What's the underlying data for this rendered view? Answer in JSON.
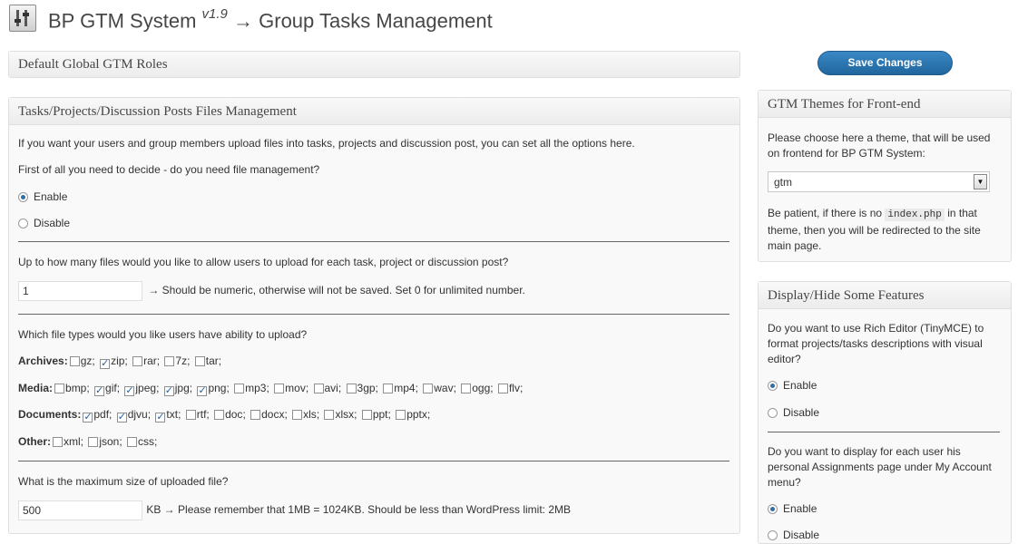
{
  "header": {
    "title_prefix": "BP GTM System",
    "version": "v1.9",
    "title_suffix": "→ Group Tasks Management",
    "logo_icon": "settings-sliders-icon"
  },
  "save_button": {
    "label": "Save Changes"
  },
  "roles_box": {
    "title": "Default Global GTM Roles"
  },
  "files_box": {
    "title": "Tasks/Projects/Discussion Posts Files Management",
    "intro": "If you want your users and group members upload files into tasks, projects and discussion post, you can set all the options here.",
    "decide": "First of all you need to decide - do you need file management?",
    "enable_label": "Enable",
    "disable_label": "Disable",
    "enabled": true,
    "count_question": "Up to how many files would you like to allow users to upload for each task, project or discussion post?",
    "count_value": "1",
    "count_note": "→ Should be numeric, otherwise will not be saved. Set 0 for unlimited number.",
    "types_question": "Which file types would you like users have ability to upload?",
    "groups": [
      {
        "label": "Archives:",
        "types": [
          {
            "name": "gz",
            "checked": false
          },
          {
            "name": "zip",
            "checked": true
          },
          {
            "name": "rar",
            "checked": false
          },
          {
            "name": "7z",
            "checked": false
          },
          {
            "name": "tar",
            "checked": false
          }
        ]
      },
      {
        "label": "Media:",
        "types": [
          {
            "name": "bmp",
            "checked": false
          },
          {
            "name": "gif",
            "checked": true
          },
          {
            "name": "jpeg",
            "checked": true
          },
          {
            "name": "jpg",
            "checked": true
          },
          {
            "name": "png",
            "checked": true
          },
          {
            "name": "mp3",
            "checked": false
          },
          {
            "name": "mov",
            "checked": false
          },
          {
            "name": "avi",
            "checked": false
          },
          {
            "name": "3gp",
            "checked": false
          },
          {
            "name": "mp4",
            "checked": false
          },
          {
            "name": "wav",
            "checked": false
          },
          {
            "name": "ogg",
            "checked": false
          },
          {
            "name": "flv",
            "checked": false
          }
        ]
      },
      {
        "label": "Documents:",
        "types": [
          {
            "name": "pdf",
            "checked": true
          },
          {
            "name": "djvu",
            "checked": true
          },
          {
            "name": "txt",
            "checked": true
          },
          {
            "name": "rtf",
            "checked": false
          },
          {
            "name": "doc",
            "checked": false
          },
          {
            "name": "docx",
            "checked": false
          },
          {
            "name": "xls",
            "checked": false
          },
          {
            "name": "xlsx",
            "checked": false
          },
          {
            "name": "ppt",
            "checked": false
          },
          {
            "name": "pptx",
            "checked": false
          }
        ]
      },
      {
        "label": "Other:",
        "types": [
          {
            "name": "xml",
            "checked": false
          },
          {
            "name": "json",
            "checked": false
          },
          {
            "name": "css",
            "checked": false
          }
        ]
      }
    ],
    "size_question": "What is the maximum size of uploaded file?",
    "size_value": "500",
    "size_note": "KB → Please remember that 1MB = 1024KB. Should be less than WordPress limit: 2MB"
  },
  "themes_box": {
    "title": "GTM Themes for Front-end",
    "desc": "Please choose here a theme, that will be used on frontend for BP GTM System:",
    "selected": "gtm",
    "note_before": "Be patient, if there is no",
    "note_code": "index.php",
    "note_after": "in that theme, then you will be redirected to the site main page."
  },
  "features_box": {
    "title": "Display/Hide Some Features",
    "q1": "Do you want to use Rich Editor (TinyMCE) to format projects/tasks descriptions with visual editor?",
    "q1_enable": "Enable",
    "q1_disable": "Disable",
    "q2": "Do you want to display for each user his personal Assignments page under My Account menu?",
    "q2_enable": "Enable",
    "q2_disable": "Disable"
  }
}
